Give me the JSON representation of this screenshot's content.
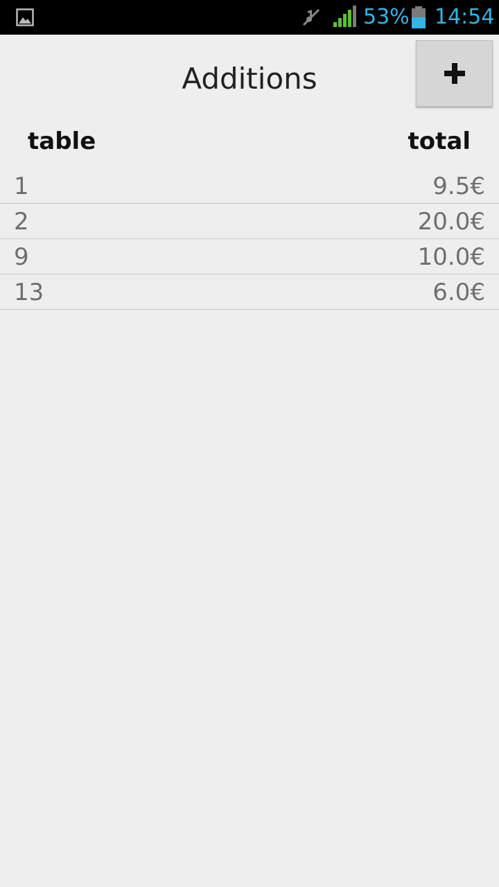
{
  "status_bar": {
    "battery_percent": "53%",
    "time": "14:54",
    "icons": [
      "image-notification-icon",
      "mute-icon",
      "signal-icon",
      "battery-icon"
    ],
    "accent_color": "#33b5e5"
  },
  "header": {
    "title": "Additions",
    "add_button_icon": "plus-icon"
  },
  "table": {
    "columns": [
      "table",
      "total"
    ],
    "rows": [
      {
        "table": "1",
        "total": "9.5€"
      },
      {
        "table": "2",
        "total": "20.0€"
      },
      {
        "table": "9",
        "total": "10.0€"
      },
      {
        "table": "13",
        "total": "6.0€"
      }
    ]
  }
}
